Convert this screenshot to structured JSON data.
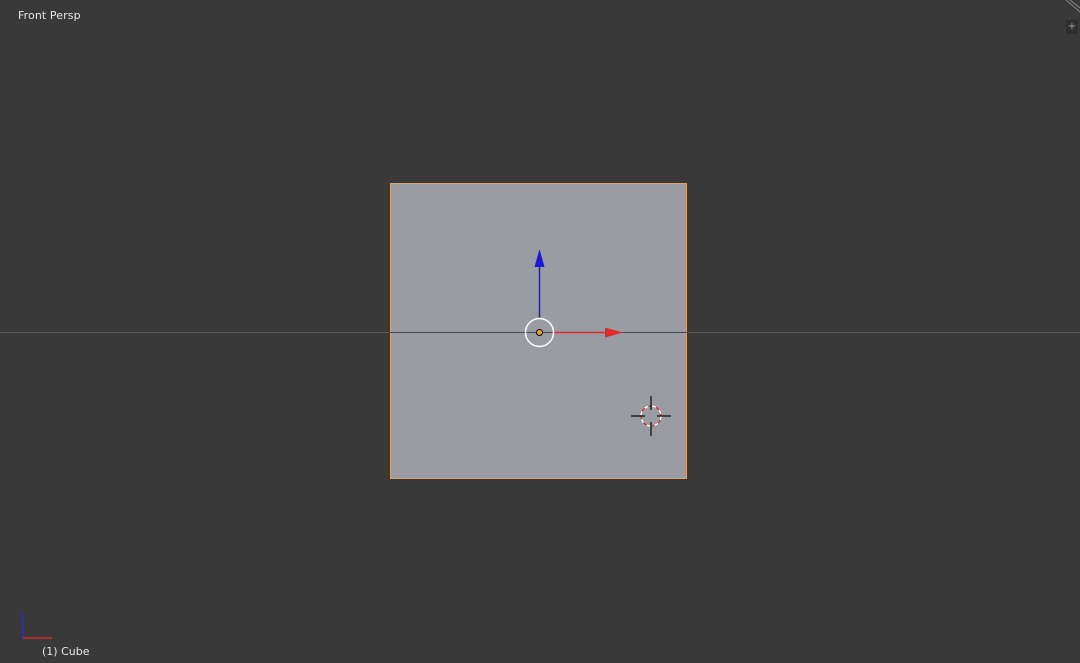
{
  "viewport": {
    "view_label": "Front Persp",
    "object_label": "(1) Cube",
    "corner_widget_glyph": "+"
  },
  "colors": {
    "background": "#393939",
    "cube_face": "#9a9ca4",
    "selection_outline": "#e0a06a",
    "x_axis": "#e02a2a",
    "z_axis": "#1a1ad8",
    "text": "#e6e6e6"
  },
  "icons": {
    "manipulator": "transform-manipulator-icon",
    "cursor": "3d-cursor-icon",
    "axes": "view-axes-icon"
  }
}
